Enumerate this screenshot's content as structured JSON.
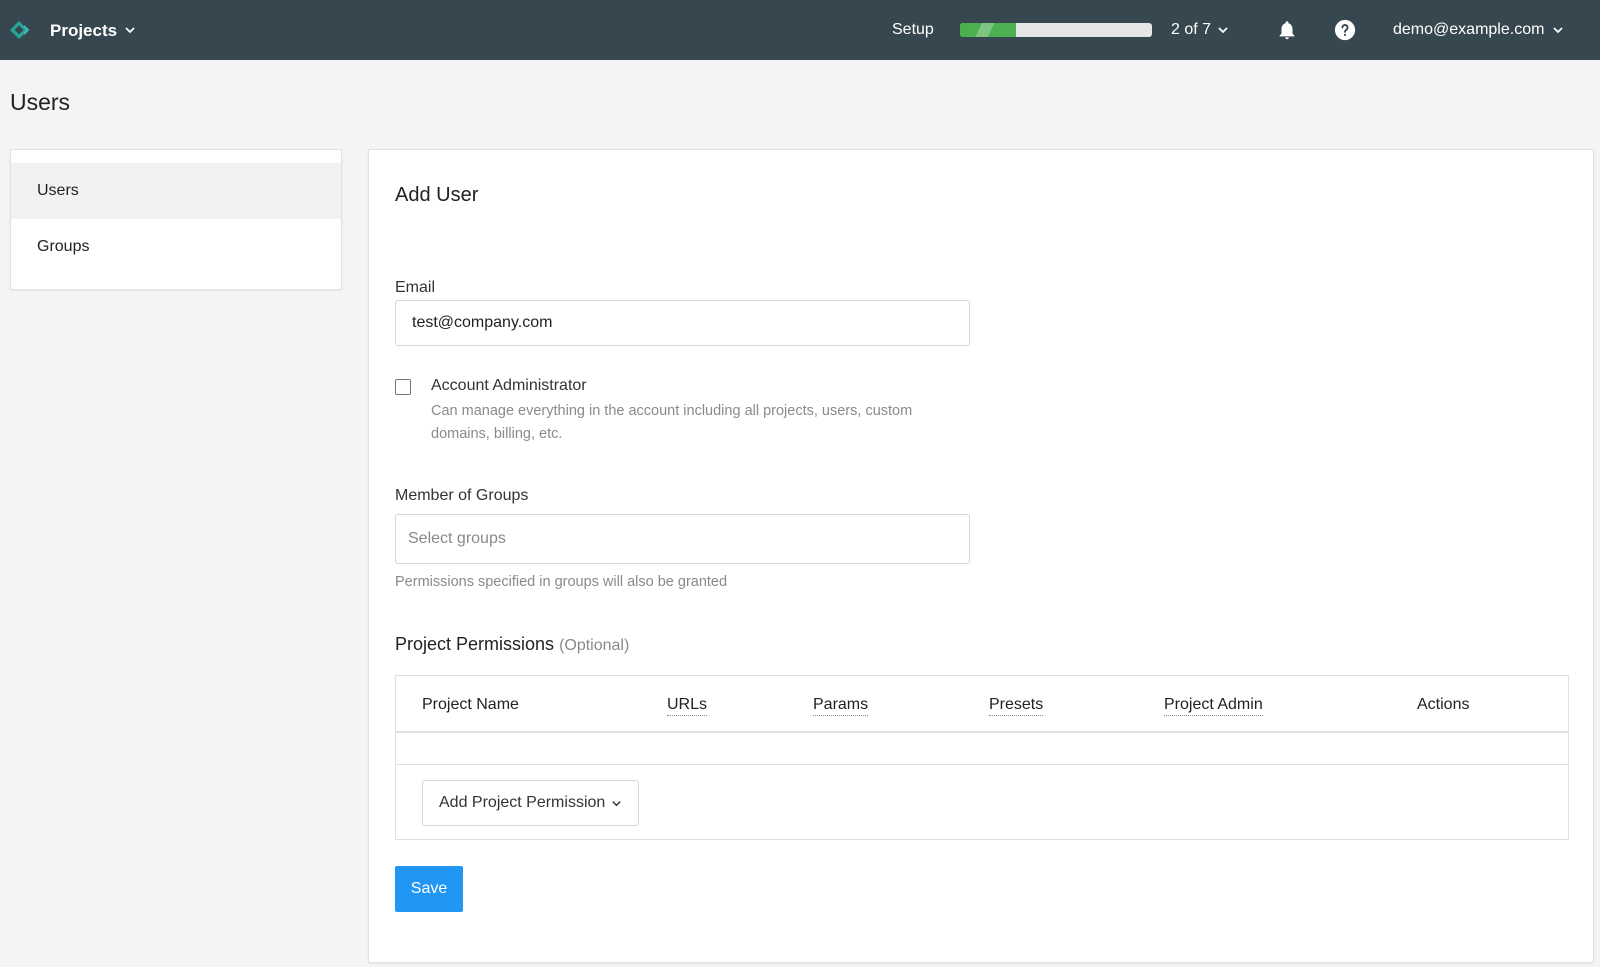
{
  "topbar": {
    "brand_label": "Projects",
    "setup_label": "Setup",
    "setup_progress": 0.29,
    "step_counter": "2 of 7",
    "account_email": "demo@example.com"
  },
  "page": {
    "title": "Users"
  },
  "sidebar": {
    "items": [
      {
        "label": "Users"
      },
      {
        "label": "Groups"
      }
    ]
  },
  "form": {
    "title": "Add User",
    "email_label": "Email",
    "email_value": "test@company.com",
    "admin_label": "Account Administrator",
    "admin_description": "Can manage everything in the account including all projects, users, custom domains, billing, etc.",
    "groups_label": "Member of Groups",
    "groups_placeholder": "Select groups",
    "groups_hint": "Permissions specified in groups will also be granted",
    "permissions_title": "Project Permissions",
    "permissions_optional": "(Optional)",
    "columns": [
      "Project Name",
      "URLs",
      "Params",
      "Presets",
      "Project Admin",
      "Actions"
    ],
    "add_permission_label": "Add Project Permission",
    "save_label": "Save"
  },
  "colors": {
    "topbar": "#37474f",
    "progress": "#4caf50",
    "primary": "#2196f3",
    "logo": "#26a69a"
  }
}
